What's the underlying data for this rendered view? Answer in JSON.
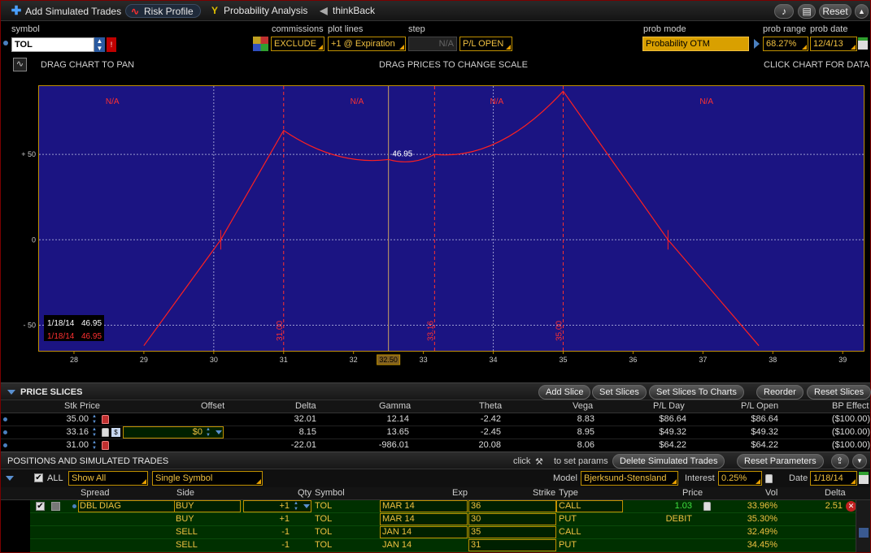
{
  "toolbar": {
    "items": [
      {
        "label": "Add Simulated Trades",
        "icon": "plus-icon"
      },
      {
        "label": "Risk Profile",
        "icon": "risk-profile-icon"
      },
      {
        "label": "Probability Analysis",
        "icon": "probability-icon"
      },
      {
        "label": "thinkBack",
        "icon": "thinkback-icon"
      }
    ],
    "reset": "Reset"
  },
  "params": {
    "symbol_label": "symbol",
    "symbol": "TOL",
    "commissions_label": "commissions",
    "commissions": "EXCLUDE",
    "plot_lines_label": "plot lines",
    "plot_lines": "+1 @ Expiration",
    "step_label": "step",
    "step": "N/A",
    "pl_mode": "P/L OPEN",
    "prob_mode_label": "prob mode",
    "prob_mode": "Probability OTM",
    "prob_range_label": "prob range",
    "prob_range": "68.27%",
    "prob_date_label": "prob date",
    "prob_date": "12/4/13"
  },
  "chart_hints": {
    "pan": "DRAG CHART TO PAN",
    "scale": "DRAG PRICES TO CHANGE SCALE",
    "data": "CLICK CHART FOR DATA"
  },
  "chart_data": {
    "type": "line",
    "x_ticks": [
      "28",
      "29",
      "30",
      "31",
      "32",
      "33",
      "34",
      "35",
      "36",
      "37",
      "38",
      "39"
    ],
    "xlim": [
      27.5,
      39.3
    ],
    "y_ticks": [
      "+ 50",
      "0",
      "- 50"
    ],
    "ylim": [
      -65,
      90
    ],
    "series": [
      {
        "values": [
          [
            29.0,
            -62
          ],
          [
            30.1,
            0
          ],
          [
            31.0,
            64
          ],
          [
            32.5,
            47
          ],
          [
            33.16,
            50
          ],
          [
            35.0,
            87
          ],
          [
            36.5,
            0
          ],
          [
            37.8,
            -62
          ]
        ]
      }
    ],
    "zone_labels": [
      "N/A",
      "N/A",
      "N/A",
      "N/A"
    ],
    "vertical_markers": [
      "31.00",
      "33.16",
      "35.00"
    ],
    "current_price": "32.50",
    "peak_label": "46.95",
    "legend": [
      {
        "date": "1/18/14",
        "value": "46.95",
        "color": "#ffffff"
      },
      {
        "date": "1/18/14",
        "value": "46.95",
        "color": "#ff3030"
      }
    ],
    "colors": {
      "background": "#1b1482",
      "line": "#ff2020",
      "grid": "#9a9ad0"
    }
  },
  "slices": {
    "title": "PRICE SLICES",
    "buttons": [
      "Add Slice",
      "Set Slices",
      "Set Slices To Charts",
      "Reorder",
      "Reset Slices"
    ],
    "columns": [
      "Stk Price",
      "Offset",
      "Delta",
      "Gamma",
      "Theta",
      "Vega",
      "P/L Day",
      "P/L Open",
      "BP Effect"
    ],
    "rows": [
      {
        "price": "35.00",
        "offset": "",
        "delta": "32.01",
        "gamma": "12.14",
        "theta": "-2.42",
        "vega": "8.83",
        "pl_day": "$86.64",
        "pl_open": "$86.64",
        "bp": "($100.00)"
      },
      {
        "price": "33.16",
        "offset": "$0",
        "delta": "8.15",
        "gamma": "13.65",
        "theta": "-2.45",
        "vega": "8.95",
        "pl_day": "$49.32",
        "pl_open": "$49.32",
        "bp": "($100.00)"
      },
      {
        "price": "31.00",
        "offset": "",
        "delta": "-22.01",
        "gamma": "-986.01",
        "theta": "20.08",
        "vega": "8.06",
        "pl_day": "$64.22",
        "pl_open": "$64.22",
        "bp": "($100.00)"
      }
    ]
  },
  "positions": {
    "title": "POSITIONS AND SIMULATED TRADES",
    "click_hint": "click",
    "set_params_hint": "to set params",
    "delete_btn": "Delete Simulated Trades",
    "reset_params_btn": "Reset Parameters",
    "all_label": "ALL",
    "show": "Show All",
    "symbol_mode": "Single Symbol",
    "model_label": "Model",
    "model": "Bjerksund-Stensland",
    "interest_label": "Interest",
    "interest": "0.25%",
    "date_label": "Date",
    "date": "1/18/14",
    "columns": [
      "Spread",
      "Side",
      "Qty",
      "Symbol",
      "Exp",
      "Strike",
      "Type",
      "Price",
      "Vol",
      "Delta"
    ],
    "rows": [
      {
        "spread": "DBL DIAG",
        "side": "BUY",
        "qty": "+1",
        "symbol": "TOL",
        "exp": "MAR 14",
        "strike": "36",
        "type": "CALL",
        "price": "1.03",
        "vol": "33.96%",
        "delta": "2.51"
      },
      {
        "spread": "",
        "side": "BUY",
        "qty": "+1",
        "symbol": "TOL",
        "exp": "MAR 14",
        "strike": "30",
        "type": "PUT",
        "price": "DEBIT",
        "vol": "35.30%",
        "delta": ""
      },
      {
        "spread": "",
        "side": "SELL",
        "qty": "-1",
        "symbol": "TOL",
        "exp": "JAN 14",
        "strike": "35",
        "type": "CALL",
        "price": "",
        "vol": "32.49%",
        "delta": ""
      },
      {
        "spread": "",
        "side": "SELL",
        "qty": "-1",
        "symbol": "TOL",
        "exp": "JAN 14",
        "strike": "31",
        "type": "PUT",
        "price": "",
        "vol": "34.45%",
        "delta": ""
      }
    ]
  }
}
